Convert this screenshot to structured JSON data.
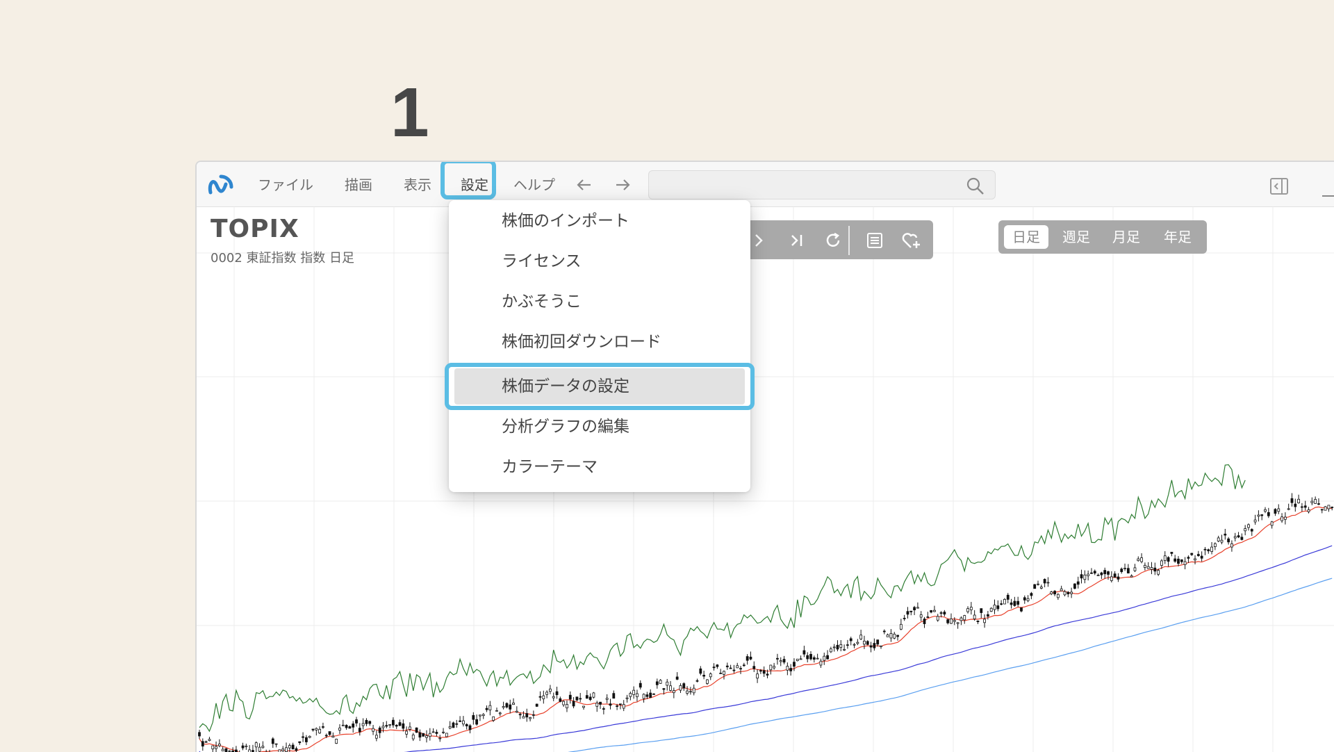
{
  "step": {
    "number": "1"
  },
  "menubar": {
    "items": [
      "ファイル",
      "描画",
      "表示",
      "設定",
      "ヘルプ"
    ],
    "active_item": "設定"
  },
  "search": {
    "value": ""
  },
  "ticker": {
    "name": "TOPIX",
    "subtitle": "0002 東証指数 指数  日足"
  },
  "periods": {
    "items": [
      "日足",
      "週足",
      "月足",
      "年足"
    ],
    "selected": "日足"
  },
  "settings_menu": {
    "items": [
      "株価のインポート",
      "ライセンス",
      "かぶそうこ",
      "株価初回ダウンロード",
      "株価データの設定",
      "分析グラフの編集",
      "カラーテーマ"
    ],
    "highlighted": "株価データの設定"
  },
  "colors": {
    "highlight": "#5bbde4",
    "logo": "#2f86cf",
    "toolbar": "#a9a9a9",
    "ma_short": "#e8402a",
    "ma_mid": "#3a3ad8",
    "ma_long": "#5a9ff0",
    "lagging_span": "#2e7d32"
  },
  "icons": [
    "logo-icon",
    "back-arrow-icon",
    "forward-arrow-icon",
    "search-icon",
    "panel-toggle-icon",
    "next-icon",
    "last-icon",
    "reload-icon",
    "list-icon",
    "favorite-add-icon"
  ]
}
